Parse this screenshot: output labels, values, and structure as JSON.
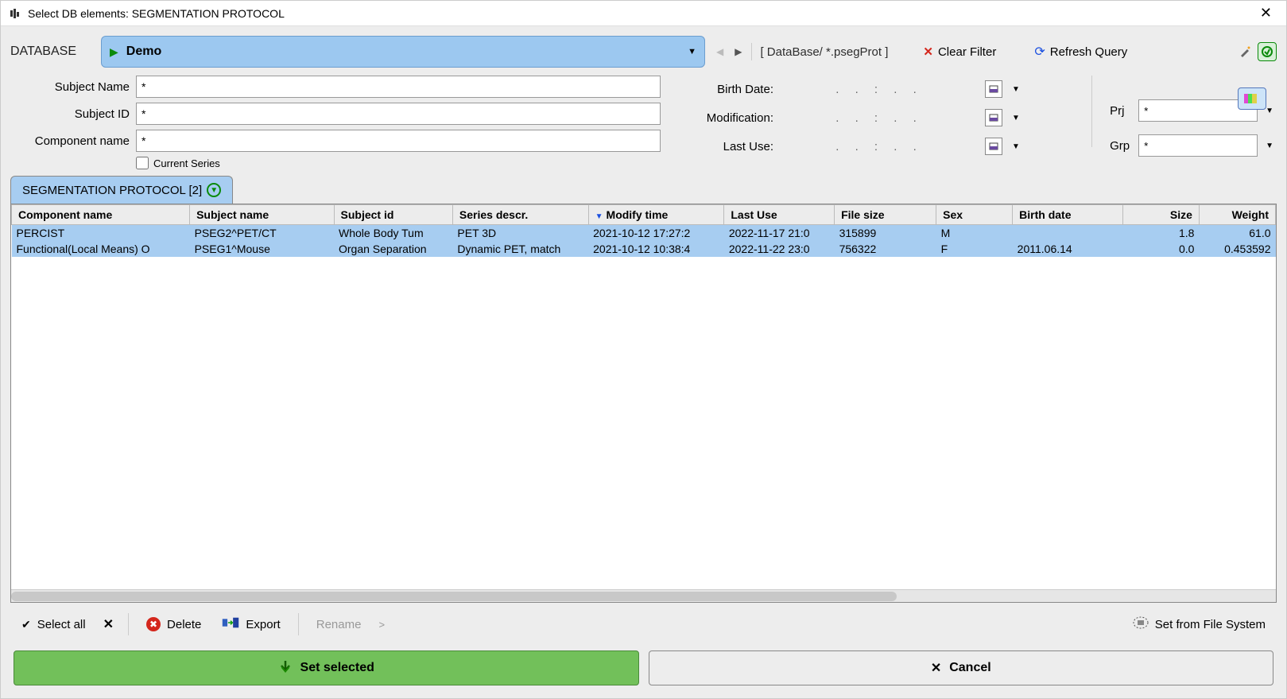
{
  "window": {
    "title": "Select DB elements: SEGMENTATION PROTOCOL"
  },
  "topbar": {
    "database_label": "DATABASE",
    "database_value": "Demo",
    "path": "[  DataBase/ *.psegProt  ]",
    "clear_filter": "Clear Filter",
    "refresh_query": "Refresh Query"
  },
  "filters": {
    "subject_name_label": "Subject Name",
    "subject_name_value": "*",
    "subject_id_label": "Subject ID",
    "subject_id_value": "*",
    "component_name_label": "Component name",
    "component_name_value": "*",
    "current_series_label": "Current Series",
    "birth_date_label": "Birth Date:",
    "modification_label": "Modification:",
    "last_use_label": "Last Use:",
    "date_placeholder": ".   .   :   .   .",
    "prj_label": "Prj",
    "prj_value": "*",
    "grp_label": "Grp",
    "grp_value": "*"
  },
  "tab": {
    "label": "SEGMENTATION PROTOCOL [2]"
  },
  "table": {
    "columns": [
      "Component name",
      "Subject name",
      "Subject id",
      "Series descr.",
      "Modify time",
      "Last Use",
      "File size",
      "Sex",
      "Birth date",
      "Size",
      "Weight"
    ],
    "sort_col_index": 4,
    "rows": [
      {
        "component": "PERCIST",
        "subject": "PSEG2^PET/CT",
        "sid": "Whole Body Tum",
        "series": "PET 3D",
        "modify": "2021-10-12 17:27:2",
        "last": "2022-11-17 21:0",
        "size": "315899",
        "sex": "M",
        "birth": "",
        "sz": "1.8",
        "wt": "61.0"
      },
      {
        "component": "Functional(Local Means) O",
        "subject": "PSEG1^Mouse",
        "sid": "Organ Separation",
        "series": "Dynamic PET, match",
        "modify": "2021-10-12 10:38:4",
        "last": "2022-11-22 23:0",
        "size": "756322",
        "sex": "F",
        "birth": "2011.06.14",
        "sz": "0.0",
        "wt": "0.453592"
      }
    ]
  },
  "toolbar": {
    "select_all": "Select all",
    "delete": "Delete",
    "export": "Export",
    "rename": "Rename",
    "rename_arrow": ">",
    "set_from_fs": "Set from File System"
  },
  "buttons": {
    "set_selected": "Set selected",
    "cancel": "Cancel"
  }
}
